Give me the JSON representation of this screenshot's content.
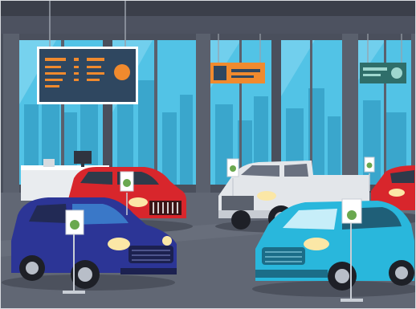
{
  "scene": {
    "description_label": "",
    "colors": {
      "ceiling": "#3b3f4a",
      "wall": "#4a4f5c",
      "glass": "#52c3e6",
      "glass_light": "#8fdcf3",
      "skyline": "#3aa6cc",
      "floor": "#616774",
      "floor_dark": "#535966",
      "column": "#5a606d",
      "board": "#2f4760",
      "board_accent": "#f08a2e",
      "sign_mid": "#f08a2e",
      "sign_right": "#2f6e6a",
      "desk": "#e9ecef",
      "car_red": "#d8262c",
      "car_navy": "#2c3596",
      "car_white": "#e3e6ea",
      "car_teal": "#29b7dc",
      "car_red_right": "#d8262c",
      "stand_badge": "#6aa84f"
    },
    "objects": [
      {
        "name": "info-board",
        "kind": "hanging display board"
      },
      {
        "name": "orange-sign",
        "kind": "hanging sign"
      },
      {
        "name": "teal-sign",
        "kind": "hanging sign"
      },
      {
        "name": "reception-desk",
        "kind": "desk with monitor"
      },
      {
        "name": "red-suv",
        "kind": "car"
      },
      {
        "name": "navy-hatchback",
        "kind": "car"
      },
      {
        "name": "white-pickup",
        "kind": "truck"
      },
      {
        "name": "teal-hatchback",
        "kind": "car"
      },
      {
        "name": "red-car-right",
        "kind": "car (partially visible)"
      },
      {
        "name": "price-stand",
        "kind": "display stand",
        "count": 5
      }
    ]
  }
}
